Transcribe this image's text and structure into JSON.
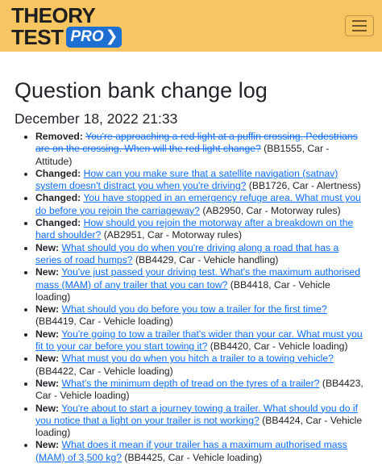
{
  "header": {
    "logo_line1": "THEORY",
    "logo_line2": "TEST",
    "logo_badge": "PRO",
    "logo_badge_chevron": "❯",
    "menu_icon": "hamburger-icon"
  },
  "page": {
    "title": "Question bank change log",
    "date": "December 18, 2022 21:33"
  },
  "changes": [
    {
      "type": "Removed:",
      "question": "You're approaching a red light at a puffin crossing. Pedestrians are on the crossing. When will the red light change?",
      "meta": " (BB1555, Car - Attitude)"
    },
    {
      "type": "Changed:",
      "question": "How can you make sure that a satellite navigation (satnav) system doesn't distract you when you're driving?",
      "meta": " (BB1726, Car - Alertness)"
    },
    {
      "type": "Changed:",
      "question": "You have stopped in an emergency refuge area. What must you do before you rejoin the carriageway?",
      "meta": " (AB2950, Car - Motorway rules)"
    },
    {
      "type": "Changed:",
      "question": "How should you rejoin the motorway after a breakdown on the hard shoulder?",
      "meta": " (AB2951, Car - Motorway rules)"
    },
    {
      "type": "New:",
      "question": "What should you do when you're driving along a road that has a series of road humps?",
      "meta": " (BB4429, Car - Vehicle handling)"
    },
    {
      "type": "New:",
      "question": "You've just passed your driving test. What's the maximum authorised mass (MAM) of any trailer that you can tow?",
      "meta": " (BB4418, Car - Vehicle loading)"
    },
    {
      "type": "New:",
      "question": "What should you do before you tow a trailer for the first time?",
      "meta": " (BB4419, Car - Vehicle loading)"
    },
    {
      "type": "New:",
      "question": "You're going to tow a trailer that's wider than your car. What must you fit to your car before you start towing it?",
      "meta": " (BB4420, Car - Vehicle loading)"
    },
    {
      "type": "New:",
      "question": "What must you do when you hitch a trailer to a towing vehicle?",
      "meta": " (BB4422, Car - Vehicle loading)"
    },
    {
      "type": "New:",
      "question": "What's the minimum depth of tread on the tyres of a trailer?",
      "meta": " (BB4423, Car - Vehicle loading)"
    },
    {
      "type": "New:",
      "question": "You're about to start a journey towing a trailer. What should you do if you notice that a light on your trailer is not working?",
      "meta": " (BB4424, Car - Vehicle loading)"
    },
    {
      "type": "New:",
      "question": "What does it mean if your trailer has a maximum authorised mass (MAM) of 3,500 kg?",
      "meta": " (BB4425, Car - Vehicle loading)"
    }
  ]
}
